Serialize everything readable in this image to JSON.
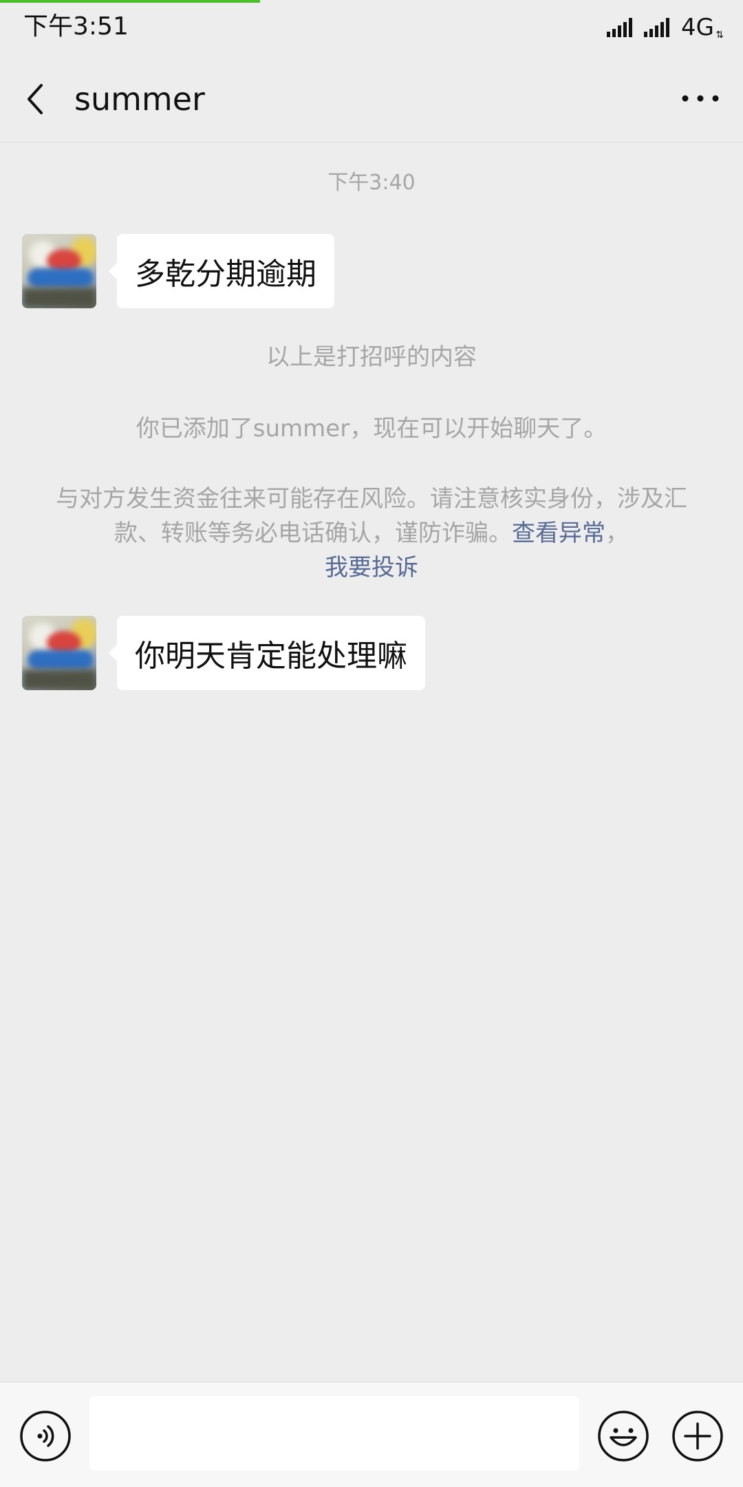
{
  "status_bar": {
    "time": "下午3:51",
    "network": "4G",
    "network_arrows": "⇅"
  },
  "header": {
    "title": "summer",
    "back_icon": "chevron-left-icon",
    "more_icon": "more-dots-icon"
  },
  "chat": {
    "timestamp": "下午3:40",
    "messages": [
      {
        "sender": "summer",
        "text": "多乾分期逾期"
      },
      {
        "sender": "summer",
        "text": "你明天肯定能处理嘛"
      }
    ],
    "system_notes": {
      "greeting_end": "以上是打招呼的内容",
      "added_friend": "你已添加了summer，现在可以开始聊天了。",
      "risk_warning": "与对方发生资金往来可能存在风险。请注意核实身份，涉及汇款、转账等务必电话确认，谨防诈骗。",
      "view_abnormal_link": "查看异常",
      "separator": "，",
      "complain_link": "我要投诉"
    }
  },
  "input_bar": {
    "voice_icon": "voice-icon",
    "input_value": "",
    "emoji_icon": "emoji-icon",
    "plus_icon": "plus-icon"
  },
  "colors": {
    "accent_progress": "#4cbf2b",
    "link": "#576b95",
    "background": "#ededed",
    "system_text": "#a6a6a6"
  }
}
